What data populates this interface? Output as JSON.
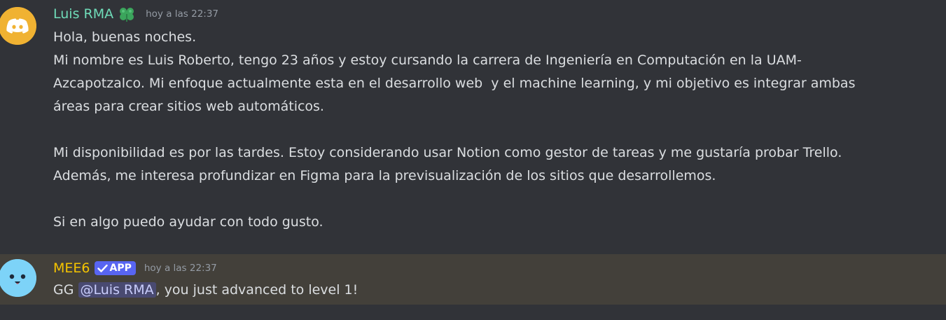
{
  "messages": [
    {
      "author": "Luis RMA",
      "author_color": "#6fdbb8",
      "role_icon": "clover-icon",
      "timestamp": "hoy a las 22:37",
      "lines": [
        "Hola, buenas noches.",
        "Mi nombre es Luis Roberto, tengo 23 años y estoy cursando la carrera de Ingeniería en Computación en la UAM-",
        "Azcapotzalco. Mi enfoque actualmente esta en el desarrollo web  y el machine learning, y mi objetivo es integrar ambas",
        "áreas para crear sitios web automáticos.",
        "",
        "Mi disponibilidad es por las tardes. Estoy considerando usar Notion como gestor de tareas y me gustaría probar Trello.",
        "Además, me interesa profundizar en Figma para la previsualización de los sitios que desarrollemos.",
        "",
        "Si en algo puedo ayudar con todo gusto."
      ]
    },
    {
      "author": "MEE6",
      "author_color": "#f5c400",
      "badge": "APP",
      "timestamp": "hoy a las 22:37",
      "text_before": "GG ",
      "mention": "@Luis RMA",
      "text_after": ", you just advanced to level 1!"
    }
  ],
  "colors": {
    "background": "#313338",
    "highlight_row": "#43403a",
    "mention_bg": "#5865f24d",
    "badge_bg": "#5865f2"
  }
}
